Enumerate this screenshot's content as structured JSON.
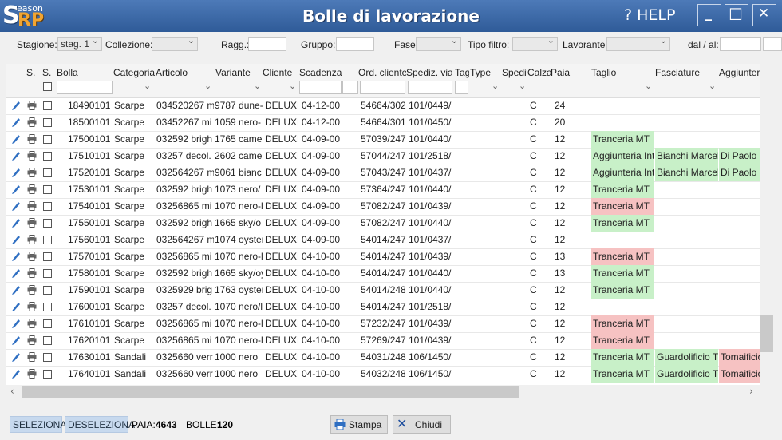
{
  "app": {
    "logo_s": "S",
    "logo_eason": "eason",
    "logo_rp": "RP",
    "title": "Bolle di lavorazione",
    "help": "? HELP",
    "minimize": "_",
    "maximize": "☐",
    "close": "✕"
  },
  "filters": {
    "stagione_label": "Stagione:",
    "stagione_value": "stag. 1",
    "collezione_label": "Collezione:",
    "ragg_label": "Ragg.:",
    "gruppo_label": "Gruppo:",
    "fase_label": "Fase:",
    "tipo_filtro_label": "Tipo filtro:",
    "lavorante_label": "Lavorante:",
    "dal_al_label": "dal / al:"
  },
  "columns": {
    "s1": "S.",
    "s2": "S.",
    "bolla": "Bolla",
    "categoria": "Categoria",
    "articolo": "Articolo",
    "variante": "Variante",
    "cliente": "Cliente",
    "scadenza": "Scadenza",
    "ord_cliente": "Ord. cliente",
    "spediz_via": "Spediz. via",
    "tag": "Tag",
    "type": "Type",
    "spedit": "Spedit",
    "calza": "Calza",
    "paia": "Paia",
    "taglio": "Taglio",
    "fasciature": "Fasciature",
    "aggiunteria": "Aggiunteria"
  },
  "rows": [
    {
      "bolla": "18490101",
      "cat": "Scarpe",
      "art": "034520267 m",
      "var": "9787 dune-",
      "cli": "DELUXE",
      "scad": "04-12-00",
      "ord": "54664/302",
      "sped": "101/0449/",
      "c": "C",
      "paia": "24",
      "taglio": "",
      "fasc": "",
      "agg": ""
    },
    {
      "bolla": "18500101",
      "cat": "Scarpe",
      "art": "03452267 mi",
      "var": "1059 nero-",
      "cli": "DELUXE",
      "scad": "04-12-00",
      "ord": "54664/301",
      "sped": "101/0450/",
      "c": "C",
      "paia": "20",
      "taglio": "",
      "fasc": "",
      "agg": ""
    },
    {
      "bolla": "17500101",
      "cat": "Scarpe",
      "art": "032592 brigh",
      "var": "1765 camel",
      "cli": "DELUXE",
      "scad": "04-09-00",
      "ord": "57039/247",
      "sped": "101/0440/",
      "c": "C",
      "paia": "12",
      "taglio": "Tranceria MT",
      "taglio_s": "green",
      "fasc": "",
      "agg": ""
    },
    {
      "bolla": "17510101",
      "cat": "Scarpe",
      "art": "03257 decol.",
      "var": "2602 camel",
      "cli": "DELUXE",
      "scad": "04-09-00",
      "ord": "57044/247",
      "sped": "101/2518/",
      "c": "C",
      "paia": "12",
      "taglio": "Aggiunteria Int",
      "taglio_s": "green",
      "fasc": "Bianchi Marcel",
      "fasc_s": "green",
      "agg": "Di Paolo",
      "agg_s": "green"
    },
    {
      "bolla": "17520101",
      "cat": "Scarpe",
      "art": "032564267 m",
      "var": "9061 bianc",
      "cli": "DELUXE",
      "scad": "04-09-00",
      "ord": "57043/247",
      "sped": "101/0437/",
      "c": "C",
      "paia": "12",
      "taglio": "Aggiunteria Int",
      "taglio_s": "green",
      "fasc": "Bianchi Marcel",
      "fasc_s": "green",
      "agg": "Di Paolo",
      "agg_s": "green"
    },
    {
      "bolla": "17530101",
      "cat": "Scarpe",
      "art": "032592 brigh",
      "var": "1073 nero/",
      "cli": "DELUXE",
      "scad": "04-09-00",
      "ord": "57364/247",
      "sped": "101/0440/",
      "c": "C",
      "paia": "12",
      "taglio": "Tranceria MT",
      "taglio_s": "green",
      "fasc": "",
      "agg": ""
    },
    {
      "bolla": "17540101",
      "cat": "Scarpe",
      "art": "03256865 mi",
      "var": "1070 nero-l",
      "cli": "DELUXE",
      "scad": "04-09-00",
      "ord": "57082/247",
      "sped": "101/0439/",
      "c": "C",
      "paia": "12",
      "taglio": "Tranceria MT",
      "taglio_s": "red",
      "fasc": "",
      "agg": ""
    },
    {
      "bolla": "17550101",
      "cat": "Scarpe",
      "art": "032592 brigh",
      "var": "1665 sky/o",
      "cli": "DELUXE",
      "scad": "04-09-00",
      "ord": "57082/247",
      "sped": "101/0440/",
      "c": "C",
      "paia": "12",
      "taglio": "Tranceria MT",
      "taglio_s": "green",
      "fasc": "",
      "agg": ""
    },
    {
      "bolla": "17560101",
      "cat": "Scarpe",
      "art": "032564267 m",
      "var": "1074 oyster",
      "cli": "DELUXE",
      "scad": "04-09-00",
      "ord": "54014/247",
      "sped": "101/0437/",
      "c": "C",
      "paia": "12",
      "taglio": "",
      "fasc": "",
      "agg": ""
    },
    {
      "bolla": "17570101",
      "cat": "Scarpe",
      "art": "03256865 mi",
      "var": "1070 nero-l",
      "cli": "DELUXE",
      "scad": "04-10-00",
      "ord": "54014/247",
      "sped": "101/0439/",
      "c": "C",
      "paia": "13",
      "taglio": "Tranceria MT",
      "taglio_s": "red",
      "fasc": "",
      "agg": ""
    },
    {
      "bolla": "17580101",
      "cat": "Scarpe",
      "art": "032592 brigh",
      "var": "1665 sky/oy",
      "cli": "DELUXE",
      "scad": "04-10-00",
      "ord": "54014/247",
      "sped": "101/0440/",
      "c": "C",
      "paia": "13",
      "taglio": "Tranceria MT",
      "taglio_s": "green",
      "fasc": "",
      "agg": ""
    },
    {
      "bolla": "17590101",
      "cat": "Scarpe",
      "art": "0325929 brig",
      "var": "1763 oyster",
      "cli": "DELUXE",
      "scad": "04-10-00",
      "ord": "54014/248",
      "sped": "101/0440/",
      "c": "C",
      "paia": "12",
      "taglio": "Tranceria MT",
      "taglio_s": "green",
      "fasc": "",
      "agg": ""
    },
    {
      "bolla": "17600101",
      "cat": "Scarpe",
      "art": "03257 decol.",
      "var": "1070 nero/l",
      "cli": "DELUXE",
      "scad": "04-10-00",
      "ord": "54014/247",
      "sped": "101/2518/",
      "c": "C",
      "paia": "12",
      "taglio": "",
      "fasc": "",
      "agg": ""
    },
    {
      "bolla": "17610101",
      "cat": "Scarpe",
      "art": "03256865 mi",
      "var": "1070 nero-l",
      "cli": "DELUXE",
      "scad": "04-10-00",
      "ord": "57232/247",
      "sped": "101/0439/",
      "c": "C",
      "paia": "12",
      "taglio": "Tranceria MT",
      "taglio_s": "red",
      "fasc": "",
      "agg": ""
    },
    {
      "bolla": "17620101",
      "cat": "Scarpe",
      "art": "03256865 mi",
      "var": "1070 nero-l",
      "cli": "DELUXE",
      "scad": "04-10-00",
      "ord": "57269/247",
      "sped": "101/0439/",
      "c": "C",
      "paia": "12",
      "taglio": "Tranceria MT",
      "taglio_s": "red",
      "fasc": "",
      "agg": ""
    },
    {
      "bolla": "17630101",
      "cat": "Sandali",
      "art": "0325660 verr",
      "var": "1000 nero",
      "cli": "DELUXE",
      "scad": "04-10-00",
      "ord": "54031/248",
      "sped": "106/1450/",
      "c": "C",
      "paia": "12",
      "taglio": "Tranceria MT",
      "taglio_s": "green",
      "fasc": "Guardolificio Tr",
      "fasc_s": "green",
      "agg": "Tomaificio",
      "agg_s": "red"
    },
    {
      "bolla": "17640101",
      "cat": "Sandali",
      "art": "0325660 verr",
      "var": "1000 nero",
      "cli": "DELUXE",
      "scad": "04-10-00",
      "ord": "54032/248",
      "sped": "106/1450/",
      "c": "C",
      "paia": "12",
      "taglio": "Tranceria MT",
      "taglio_s": "green",
      "fasc": "Guardolificio Tr",
      "fasc_s": "green",
      "agg": "Tomaificio",
      "agg_s": "red"
    }
  ],
  "footer": {
    "seleziona": "SELEZIONA",
    "deseleziona": "DESELEZIONA",
    "paia_label": "PAIA:",
    "paia_value": "4643",
    "bolle_label": "BOLLE:",
    "bolle_value": "120",
    "stampa": "Stampa",
    "chiudi": "Chiudi"
  },
  "colors": {
    "green": "#c8f0c8",
    "red": "#f6c2c2",
    "titlebar": "#3b68a8",
    "accent": "#2f6fc2"
  }
}
